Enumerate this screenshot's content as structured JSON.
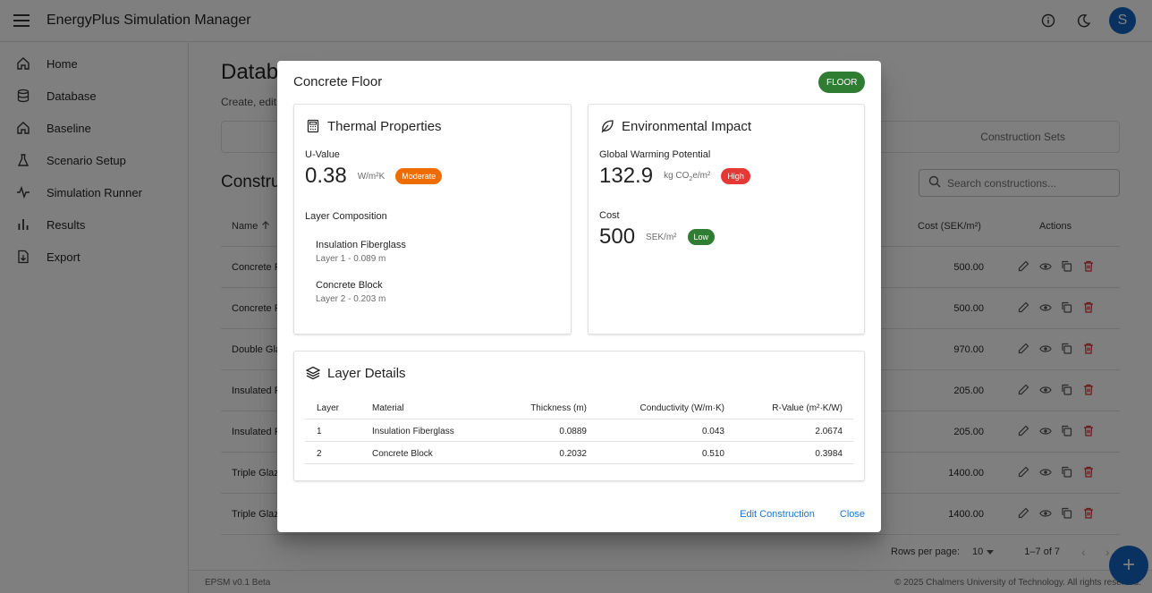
{
  "app": {
    "title": "EnergyPlus Simulation Manager",
    "avatar_letter": "S"
  },
  "sidebar": {
    "items": [
      {
        "label": "Home",
        "icon": "home-icon"
      },
      {
        "label": "Database",
        "icon": "database-icon"
      },
      {
        "label": "Baseline",
        "icon": "home-icon"
      },
      {
        "label": "Scenario Setup",
        "icon": "flask-icon"
      },
      {
        "label": "Simulation Runner",
        "icon": "pulse-icon"
      },
      {
        "label": "Results",
        "icon": "bar-chart-icon"
      },
      {
        "label": "Export",
        "icon": "export-icon"
      }
    ]
  },
  "main": {
    "title": "Datab",
    "subtitle": "Create, edit",
    "tab_sets": "Construction Sets",
    "section_title": "Constru",
    "search_placeholder": "Search constructions...",
    "table": {
      "col_name": "Name",
      "col_cost": "Cost (SEK/m²)",
      "col_actions": "Actions",
      "rows": [
        {
          "name": "Concrete F",
          "cost": "500.00"
        },
        {
          "name": "Concrete F",
          "cost": "500.00"
        },
        {
          "name": "Double Glaz",
          "cost": "970.00"
        },
        {
          "name": "Insulated F",
          "cost": "205.00"
        },
        {
          "name": "Insulated F",
          "cost": "205.00"
        },
        {
          "name": "Triple Glaz",
          "cost": "1400.00"
        },
        {
          "name": "Triple Glaz",
          "cost": "1400.00"
        }
      ]
    },
    "pagination": {
      "rows_label": "Rows per page:",
      "rows_value": "10",
      "range": "1–7 of 7"
    }
  },
  "footer": {
    "version": "EPSM v0.1 Beta",
    "copyright": "© 2025 Chalmers University of Technology. All rights reserved."
  },
  "dialog": {
    "title": "Concrete Floor",
    "type_chip": "FLOOR",
    "thermal": {
      "heading": "Thermal Properties",
      "u_label": "U-Value",
      "u_value": "0.38",
      "u_unit": "W/m²K",
      "u_rating": "Moderate",
      "layers_heading": "Layer Composition",
      "layers": [
        {
          "name": "Insulation Fiberglass",
          "detail": "Layer 1 - 0.089 m"
        },
        {
          "name": "Concrete Block",
          "detail": "Layer 2 - 0.203 m"
        }
      ]
    },
    "environment": {
      "heading": "Environmental Impact",
      "gwp_label": "Global Warming Potential",
      "gwp_value": "132.9",
      "gwp_unit_pre": "kg CO",
      "gwp_unit_sub": "2",
      "gwp_unit_post": "e/m²",
      "gwp_rating": "High",
      "cost_label": "Cost",
      "cost_value": "500",
      "cost_unit": "SEK/m²",
      "cost_rating": "Low"
    },
    "layer_details": {
      "heading": "Layer Details",
      "headers": {
        "layer": "Layer",
        "material": "Material",
        "thickness": "Thickness (m)",
        "conductivity": "Conductivity (W/m·K)",
        "r_value": "R-Value (m²·K/W)"
      },
      "rows": [
        {
          "layer": "1",
          "material": "Insulation Fiberglass",
          "thickness": "0.0889",
          "conductivity": "0.043",
          "r_value": "2.0674"
        },
        {
          "layer": "2",
          "material": "Concrete Block",
          "thickness": "0.2032",
          "conductivity": "0.510",
          "r_value": "0.3984"
        }
      ]
    },
    "actions": {
      "edit": "Edit Construction",
      "close": "Close"
    }
  },
  "colors": {
    "primary": "#1976d2",
    "floor_chip": "#2e7d32",
    "moderate": "#ef6c00",
    "high": "#e53935",
    "low": "#2e7d32",
    "delete": "#d32f2f"
  }
}
